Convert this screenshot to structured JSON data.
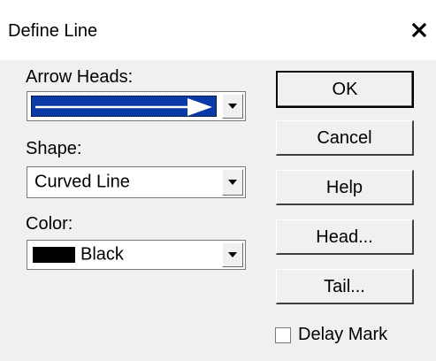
{
  "window": {
    "title": "Define Line",
    "close_icon": "close-icon"
  },
  "fields": {
    "arrow_heads": {
      "label": "Arrow Heads:",
      "selected_icon": "arrow-right-filled-head",
      "line_color": "#ffffff",
      "selection_color": "#0a3aa6"
    },
    "shape": {
      "label": "Shape:",
      "value": "Curved Line"
    },
    "color": {
      "label": "Color:",
      "value": "Black",
      "swatch_color": "#000000"
    }
  },
  "buttons": {
    "ok": "OK",
    "cancel": "Cancel",
    "help": "Help",
    "head": "Head...",
    "tail": "Tail..."
  },
  "options": {
    "delay_mark_label": "Delay Mark",
    "delay_mark_checked": false
  }
}
